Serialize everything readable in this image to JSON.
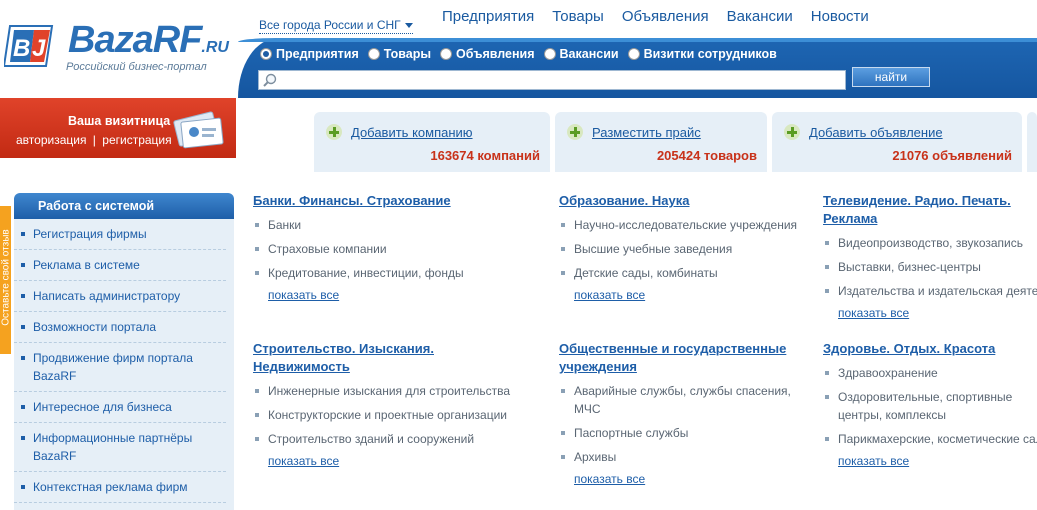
{
  "header": {
    "logo_text": "BazaRF",
    "logo_suffix": ".RU",
    "logo_tagline": "Российский бизнес-портал",
    "city_select": "Все города России и СНГ",
    "nav": [
      "Предприятия",
      "Товары",
      "Объявления",
      "Вакансии",
      "Новости"
    ]
  },
  "search": {
    "options": [
      "Предприятия",
      "Товары",
      "Объявления",
      "Вакансии",
      "Визитки сотрудников"
    ],
    "selected": "Предприятия",
    "value": "",
    "button_label": "найти"
  },
  "vcard": {
    "title": "Ваша визитница",
    "login_label": "авторизация",
    "separator": "|",
    "register_label": "регистрация"
  },
  "stats": [
    {
      "action": "Добавить компанию",
      "count": "163674 компаний"
    },
    {
      "action": "Разместить прайс",
      "count": "205424 товаров"
    },
    {
      "action": "Добавить объявление",
      "count": "21076 объявлений"
    }
  ],
  "feedback_tab": "Оставьте свой отзыв",
  "sidebar": {
    "title": "Работа с системой",
    "items": [
      "Регистрация фирмы",
      "Реклама в системе",
      "Написать администратору",
      "Возможности портала",
      "Продвижение фирм портала BazaRF",
      "Интересное для бизнеса",
      "Информационные партнёры BazaRF",
      "Контекстная реклама фирм"
    ]
  },
  "categories": [
    {
      "title": "Банки. Финансы. Страхование",
      "items": [
        "Банки",
        "Страховые компании",
        "Кредитование, инвестиции, фонды"
      ],
      "more": "показать все"
    },
    {
      "title": "Образование. Наука",
      "items": [
        "Научно-исследовательские учреждения",
        "Высшие учебные заведения",
        "Детские сады, комбинаты"
      ],
      "more": "показать все"
    },
    {
      "title": "Телевидение. Радио. Печать. Реклама",
      "items": [
        "Видеопроизводство, звукозапись",
        "Выставки, бизнес-центры",
        "Издательства и издательская деятельность"
      ],
      "more": "показать все"
    },
    {
      "title": "Строительство. Изыскания. Недвижимость",
      "items": [
        "Инженерные изыскания для строительства",
        "Конструкторские и проектные организации",
        "Строительство зданий и сооружений"
      ],
      "more": "показать все"
    },
    {
      "title": "Общественные и государственные учреждения",
      "items": [
        "Аварийные службы, службы спасения, МЧС",
        "Паспортные службы",
        "Архивы"
      ],
      "more": "показать все"
    },
    {
      "title": "Здоровье. Отдых. Красота",
      "items": [
        "Здравоохранение",
        "Оздоровительные, спортивные центры, комплексы",
        "Парикмахерские, косметические салоны"
      ],
      "more": "показать все"
    }
  ],
  "colors": {
    "brand_blue": "#1e5ea8",
    "accent_red": "#c8321a",
    "panel_bg": "#e6eff7",
    "feedback_orange": "#f5a21f"
  }
}
